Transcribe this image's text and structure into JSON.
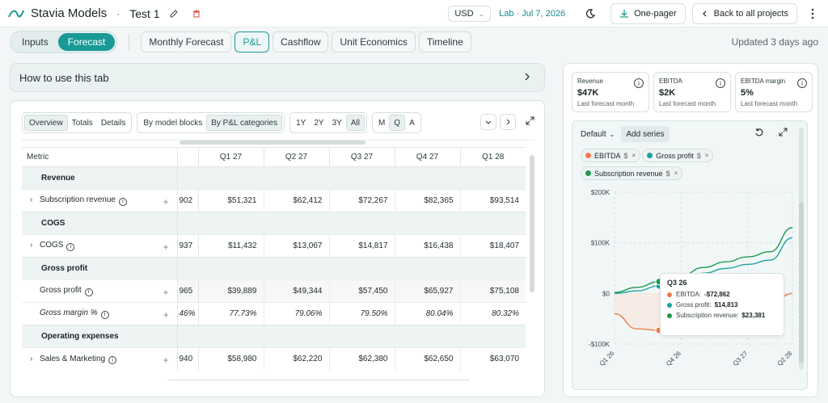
{
  "header": {
    "app_name": "Stavia Models",
    "separator": "·",
    "project_name": "Test 1",
    "currency": "USD",
    "lab_text": "Lab · Jul 7, 2026",
    "onepager_label": "One-pager",
    "back_label": "Back to all projects"
  },
  "modes": [
    {
      "label": "Inputs",
      "active": false
    },
    {
      "label": "Forecast",
      "active": true
    }
  ],
  "tabs": [
    {
      "label": "Monthly Forecast",
      "active": false
    },
    {
      "label": "P&L",
      "active": true
    },
    {
      "label": "Cashflow",
      "active": false
    },
    {
      "label": "Unit Economics",
      "active": false
    },
    {
      "label": "Timeline",
      "active": false
    }
  ],
  "updated": "Updated 3 days ago",
  "howto": "How to use this tab",
  "table_toolbar": {
    "view": [
      "Overview",
      "Totals",
      "Details"
    ],
    "grouping": [
      "By model blocks",
      "By P&L categories"
    ],
    "range": [
      "1Y",
      "2Y",
      "3Y",
      "All"
    ],
    "period": [
      "M",
      "Q",
      "A"
    ]
  },
  "table": {
    "metric_header": "Metric",
    "columns": [
      "Q1 27",
      "Q2 27",
      "Q3 27",
      "Q4 27",
      "Q1 28"
    ],
    "rows": [
      {
        "type": "section",
        "label": "Revenue"
      },
      {
        "type": "row",
        "label": "Subscription revenue",
        "expand": true,
        "partial": "902",
        "values": [
          "$51,321",
          "$62,412",
          "$72,267",
          "$82,365",
          "$93,514"
        ]
      },
      {
        "type": "section",
        "label": "COGS"
      },
      {
        "type": "row",
        "label": "COGS",
        "expand": true,
        "partial": "937",
        "values": [
          "$11,432",
          "$13,067",
          "$14,817",
          "$16,438",
          "$18,407"
        ]
      },
      {
        "type": "section",
        "label": "Gross profit"
      },
      {
        "type": "row",
        "label": "Gross profit",
        "expand": false,
        "partial": "965",
        "tint": true,
        "values": [
          "$39,889",
          "$49,344",
          "$57,450",
          "$65,927",
          "$75,108"
        ]
      },
      {
        "type": "row",
        "label": "Gross margin %",
        "expand": false,
        "partial": "46%",
        "italic": true,
        "values": [
          "77.73%",
          "79.06%",
          "79.50%",
          "80.04%",
          "80.32%"
        ]
      },
      {
        "type": "section",
        "label": "Operating expenses"
      },
      {
        "type": "row",
        "label": "Sales & Marketing",
        "expand": true,
        "partial": "940",
        "values": [
          "$58,980",
          "$62,220",
          "$62,380",
          "$62,650",
          "$63,070"
        ]
      }
    ]
  },
  "kpis": [
    {
      "label": "Revenue",
      "value": "$47K",
      "sub": "Last forecast month"
    },
    {
      "label": "EBITDA",
      "value": "$2K",
      "sub": "Last forecast month"
    },
    {
      "label": "EBITDA margin",
      "value": "5%",
      "sub": "Last forecast month"
    }
  ],
  "chart_toolbar": {
    "default_label": "Default",
    "add_series_label": "Add series"
  },
  "chips": [
    {
      "label": "EBITDA",
      "unit": "$",
      "color": "#f07a4a"
    },
    {
      "label": "Gross profit",
      "unit": "$",
      "color": "#1aa39f"
    },
    {
      "label": "Subscription revenue",
      "unit": "$",
      "color": "#1e9a50"
    }
  ],
  "tooltip": {
    "title": "Q3 26",
    "rows": [
      {
        "label": "EBITDA:",
        "value": "-$72,862",
        "color": "#f07a4a"
      },
      {
        "label": "Gross profit:",
        "value": "$14,813",
        "color": "#1aa39f"
      },
      {
        "label": "Subscription revenue:",
        "value": "$23,381",
        "color": "#1e9a50"
      }
    ]
  },
  "chart_data": {
    "type": "line",
    "x": [
      "Q1 26",
      "Q2 26",
      "Q3 26",
      "Q4 26",
      "Q1 27",
      "Q2 27",
      "Q3 27",
      "Q4 27",
      "Q1 28"
    ],
    "xticks": [
      "Q1 26",
      "Q4 26",
      "Q3 27",
      "Q2 28"
    ],
    "yticks": [
      "$200K",
      "$100K",
      "$0",
      "-$100K"
    ],
    "ylim": [
      -100000,
      200000
    ],
    "series": [
      {
        "name": "EBITDA",
        "color": "#f07a4a",
        "values": [
          -40000,
          -70000,
          -72862,
          -68000,
          -60000,
          -50000,
          -38000,
          -22000,
          0
        ]
      },
      {
        "name": "Gross profit",
        "color": "#1aa39f",
        "values": [
          0,
          5000,
          14813,
          25000,
          40000,
          49344,
          57450,
          65927,
          110000
        ]
      },
      {
        "name": "Subscription revenue",
        "color": "#1e9a50",
        "values": [
          2000,
          12000,
          23381,
          35000,
          51321,
          62412,
          72267,
          82365,
          130000
        ]
      }
    ],
    "highlight_index": 2,
    "grid": true,
    "legend": "top-left chips"
  }
}
